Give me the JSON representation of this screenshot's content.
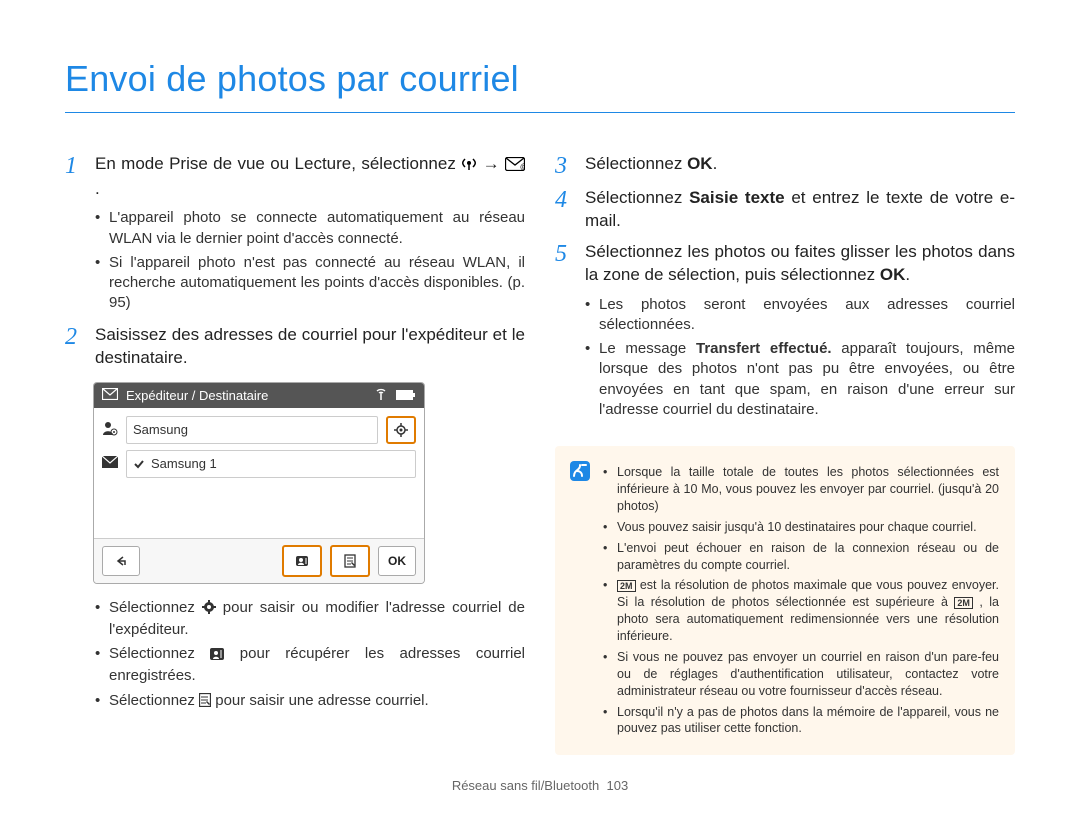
{
  "title": "Envoi de photos par courriel",
  "footer": {
    "section": "Réseau sans fil/Bluetooth",
    "page": "103"
  },
  "left": {
    "step1": {
      "num": "1",
      "text": "En mode Prise de vue ou Lecture, sélectionnez ",
      "arrow": " → ",
      "period": "."
    },
    "step1_sub": [
      "L'appareil photo se connecte automatiquement au réseau WLAN via le dernier point d'accès connecté.",
      "Si l'appareil photo n'est pas connecté au réseau WLAN, il recherche automatiquement les points d'accès disponibles. (p. 95)"
    ],
    "step2": {
      "num": "2",
      "text": "Saisissez des adresses de courriel pour l'expéditeur et le destinataire."
    },
    "screenshot": {
      "head_label": "Expéditeur / Destinataire",
      "row1": "Samsung",
      "row2": "Samsung 1",
      "ok": "OK"
    },
    "after_ss": {
      "a_pre": "Sélectionnez ",
      "a_post": " pour saisir ou modifier l'adresse courriel de l'expéditeur.",
      "b_pre": "Sélectionnez ",
      "b_post": " pour récupérer les adresses courriel enregistrées.",
      "c_pre": "Sélectionnez ",
      "c_post": " pour saisir une adresse courriel."
    }
  },
  "right": {
    "step3": {
      "num": "3",
      "pre": "Sélectionnez ",
      "bold": "OK",
      "post": "."
    },
    "step4": {
      "num": "4",
      "pre": "Sélectionnez ",
      "bold": "Saisie texte",
      "post": " et entrez le texte de votre e-mail."
    },
    "step5": {
      "num": "5",
      "pre": "Sélectionnez les photos ou faites glisser les photos dans la zone de sélection, puis sélectionnez ",
      "bold": "OK",
      "post": "."
    },
    "step5_sub": {
      "a": "Les photos seront envoyées aux adresses courriel sélectionnées.",
      "b_pre": "Le message ",
      "b_bold": "Transfert effectué.",
      "b_post": " apparaît toujours, même lorsque des photos n'ont pas pu être envoyées, ou être envoyées en tant que spam, en raison d'une erreur sur l'adresse courriel du destinataire."
    },
    "infobox": [
      "Lorsque la taille totale de toutes les photos sélectionnées est inférieure à 10 Mo, vous pouvez les envoyer par courriel. (jusqu'à 20 photos)",
      "Vous pouvez saisir jusqu'à 10 destinataires pour chaque courriel.",
      "L'envoi peut échouer en raison de la connexion réseau ou de paramètres du compte courriel.",
      {
        "t4a": " est la résolution de photos maximale que vous pouvez envoyer. Si la résolution de photos sélectionnée est supérieure à ",
        "t4b": " , la photo sera automatiquement redimensionnée vers une résolution inférieure."
      },
      "Si vous ne pouvez pas envoyer un courriel en raison d'un pare-feu ou de réglages d'authentification utilisateur, contactez votre administrateur réseau ou votre fournisseur d'accès réseau.",
      "Lorsqu'il n'y a pas de photos dans la mémoire de l'appareil, vous ne pouvez pas utiliser cette fonction."
    ],
    "res_label": "2M"
  }
}
